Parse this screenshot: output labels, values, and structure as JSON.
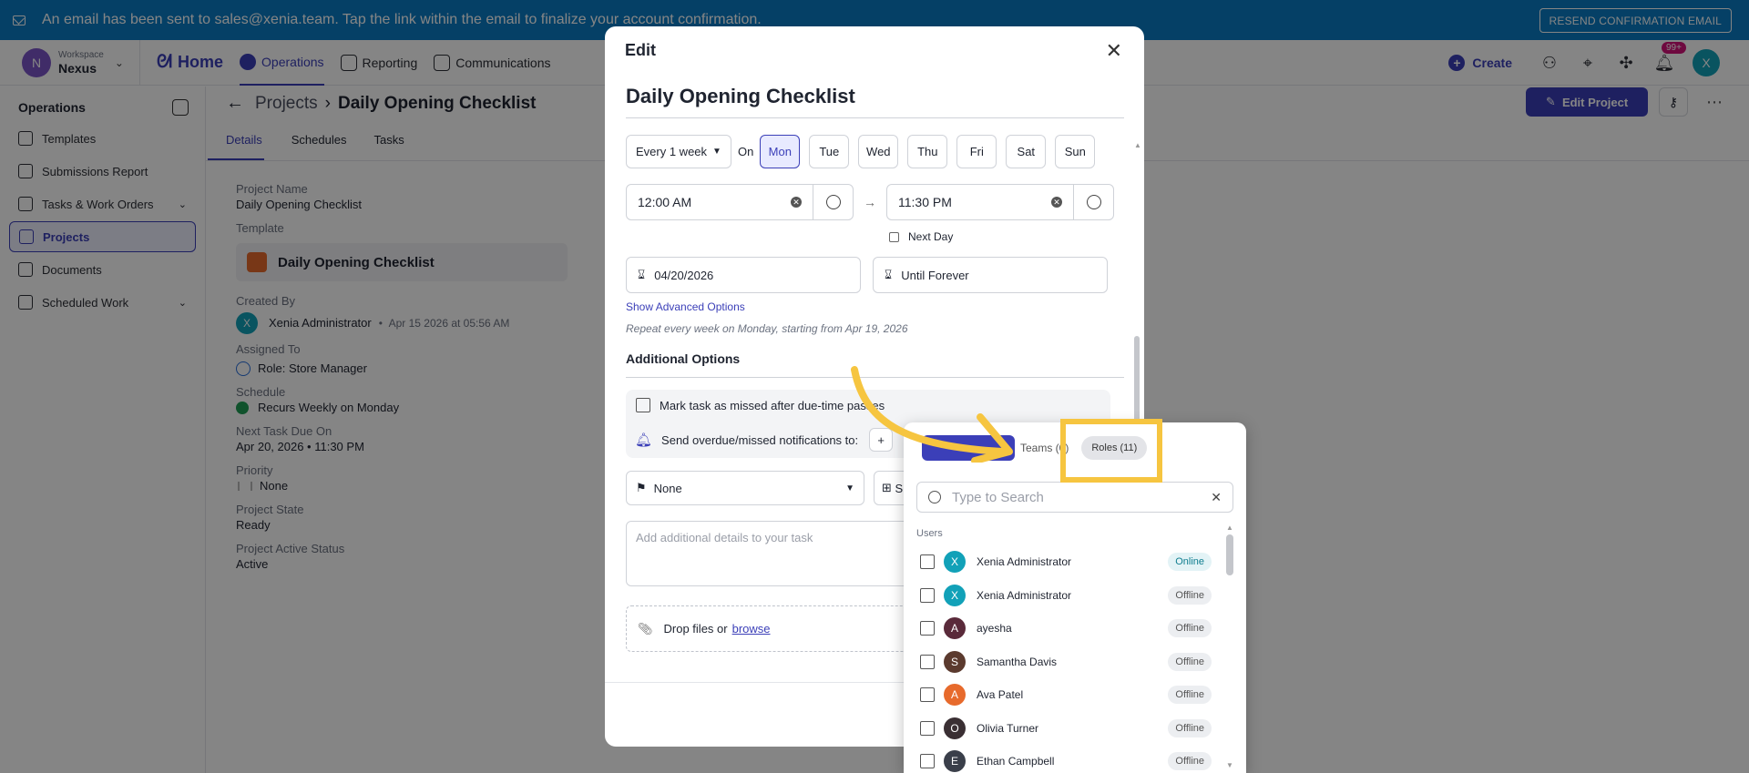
{
  "banner": {
    "message": "An email has been sent to sales@xenia.team. Tap the link within the email to finalize your account confirmation.",
    "resend_label": "RESEND CONFIRMATION EMAIL"
  },
  "topnav": {
    "workspace_label": "Workspace",
    "workspace_name": "Nexus",
    "workspace_initial": "N",
    "home_label": "Home",
    "items": [
      {
        "label": "Operations",
        "icon": "check-circle-icon",
        "active": true
      },
      {
        "label": "Reporting",
        "icon": "chart-icon"
      },
      {
        "label": "Communications",
        "icon": "chat-icon"
      }
    ],
    "create_label": "Create",
    "notification_count": "99+",
    "user_initial": "X"
  },
  "sidebar": {
    "title": "Operations",
    "items": [
      {
        "label": "Templates"
      },
      {
        "label": "Submissions Report"
      },
      {
        "label": "Tasks & Work Orders"
      },
      {
        "label": "Projects"
      },
      {
        "label": "Documents"
      },
      {
        "label": "Scheduled Work"
      }
    ]
  },
  "page": {
    "crumb_parent": "Projects",
    "crumb_current": "Daily Opening Checklist",
    "tabs": [
      "Details",
      "Schedules",
      "Tasks"
    ],
    "edit_project_label": "Edit Project",
    "fields": {
      "project_name_label": "Project Name",
      "project_name": "Daily Opening Checklist",
      "template_label": "Template",
      "template_name": "Daily Opening Checklist",
      "created_by_label": "Created By",
      "created_by": "Xenia Administrator",
      "created_at": "Apr 15 2026 at 05:56 AM",
      "assigned_label": "Assigned To",
      "assigned": "Role: Store Manager",
      "schedule_label": "Schedule",
      "schedule": "Recurs Weekly on Monday",
      "next_due_label": "Next Task Due On",
      "next_due": "Apr 20, 2026 • 11:30 PM",
      "priority_label": "Priority",
      "priority": "None",
      "state_label": "Project State",
      "state": "Ready",
      "active_label": "Project Active Status",
      "active": "Active"
    }
  },
  "modal": {
    "title": "Edit",
    "task_title": "Daily Opening Checklist",
    "frequency": "Every 1 week",
    "on_label": "On",
    "days": [
      "Mon",
      "Tue",
      "Wed",
      "Thu",
      "Fri",
      "Sat",
      "Sun"
    ],
    "selected_day": "Mon",
    "start_time": "12:00 AM",
    "end_time": "11:30 PM",
    "next_day_label": "Next Day",
    "start_date": "04/20/2026",
    "end_date": "Until Forever",
    "advanced_label": "Show Advanced Options",
    "repeat_summary": "Repeat every week on Monday, starting from Apr 19, 2026",
    "additional_label": "Additional Options",
    "missed_label": "Mark task as missed after due-time passes",
    "notify_label": "Send overdue/missed notifications to:",
    "priority_value": "None",
    "second_select_fragment": "S",
    "details_placeholder": "Add additional details to your task",
    "drop_label": "Drop files or",
    "browse_label": "browse"
  },
  "popover": {
    "teams_tab": "Teams (0)",
    "roles_tab": "Roles (11)",
    "search_placeholder": "Type to Search",
    "users_label": "Users",
    "users": [
      {
        "initial": "X",
        "name": "Xenia Administrator",
        "status": "Online",
        "color": "#12a1b8"
      },
      {
        "initial": "X",
        "name": "Xenia Administrator",
        "status": "Offline",
        "color": "#12a1b8"
      },
      {
        "initial": "A",
        "name": "ayesha",
        "status": "Offline",
        "color": "#5a2a3a"
      },
      {
        "initial": "S",
        "name": "Samantha Davis",
        "status": "Offline",
        "color": "#5b3a2e"
      },
      {
        "initial": "A",
        "name": "Ava Patel",
        "status": "Offline",
        "color": "#e76a2c"
      },
      {
        "initial": "O",
        "name": "Olivia Turner",
        "status": "Offline",
        "color": "#3a2f33"
      },
      {
        "initial": "E",
        "name": "Ethan Campbell",
        "status": "Offline",
        "color": "#3a3f4a"
      }
    ]
  },
  "colors": {
    "banner": "#0b7cc4",
    "brand": "#3b3fb8",
    "highlight": "#f6c540"
  }
}
